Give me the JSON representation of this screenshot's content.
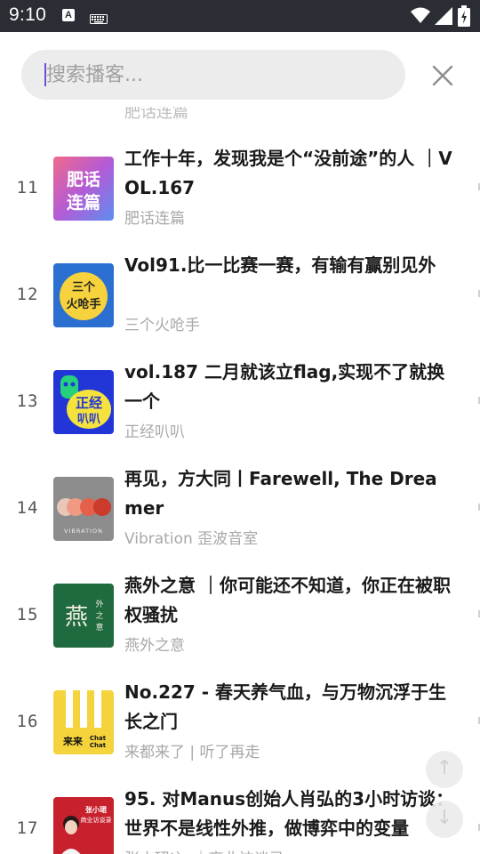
{
  "status_bar": {
    "time": "9:10",
    "a_glyph": "A",
    "icons": [
      "a-notification-icon",
      "keyboard-icon",
      "wifi-icon",
      "signal-icon",
      "battery-icon"
    ]
  },
  "search": {
    "placeholder": "搜索播客...",
    "value": ""
  },
  "colors": {
    "status_bar_bg": "#2b2d35",
    "search_bg": "#ececec",
    "title_text": "#1a1a1a",
    "author_text": "#a8a8a8",
    "caret": "#6d4fd0"
  },
  "list": {
    "peek_text": "肥话连篇",
    "items": [
      {
        "rank": "11",
        "title": "工作十年，发现我是个“没前途”的人 ｜VOL.167",
        "author": "肥话连篇",
        "cover_text": [
          "肥话",
          "连篇"
        ]
      },
      {
        "rank": "12",
        "title": "Vol91.比一比赛一赛，有输有赢别见外",
        "author": "三个火呛手",
        "cover_text": [
          "三个",
          "火呛手"
        ]
      },
      {
        "rank": "13",
        "title": "vol.187 二月就该立flag,实现不了就换一个",
        "author": "正经叭叭",
        "cover_text": [
          "正经",
          "叭叭"
        ]
      },
      {
        "rank": "14",
        "title": "再见，方大同丨Farewell, The Dreamer",
        "author": "Vibration 歪波音室",
        "cover_text": [
          "VIBRATION"
        ]
      },
      {
        "rank": "15",
        "title": "燕外之意 ｜你可能还不知道，你正在被职权骚扰",
        "author": "燕外之意",
        "cover_text": [
          "燕",
          "外",
          "之",
          "意"
        ]
      },
      {
        "rank": "16",
        "title": "No.227 - 春天养气血，与万物沉浮于生长之门",
        "author": "来都来了 | 听了再走",
        "cover_text": [
          "来来",
          "Chat",
          "Chat"
        ]
      },
      {
        "rank": "17",
        "title": "95. 对Manus创始人肖弘的3小时访谈：世界不是线性外推，做博弈中的变量",
        "author": "张小珺Jùn｜商业访谈录",
        "cover_text": [
          "张小珺",
          "商业访谈录"
        ]
      }
    ]
  },
  "scroll_buttons": {
    "up_glyph": "↑",
    "down_glyph": "↓"
  }
}
